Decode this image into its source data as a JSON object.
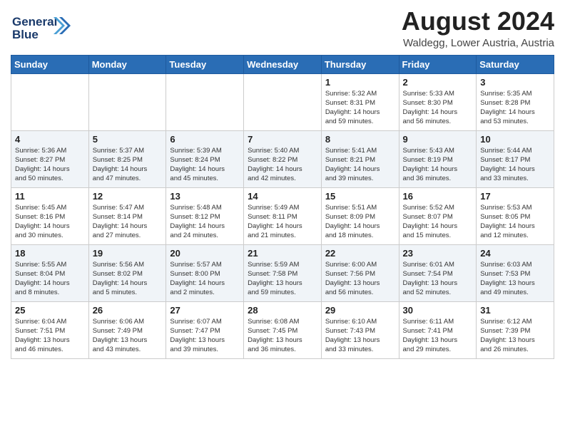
{
  "header": {
    "logo_line1": "General",
    "logo_line2": "Blue",
    "month_year": "August 2024",
    "location": "Waldegg, Lower Austria, Austria"
  },
  "days_of_week": [
    "Sunday",
    "Monday",
    "Tuesday",
    "Wednesday",
    "Thursday",
    "Friday",
    "Saturday"
  ],
  "weeks": [
    [
      {
        "empty": true
      },
      {
        "empty": true
      },
      {
        "empty": true
      },
      {
        "empty": true
      },
      {
        "day": 1,
        "sunrise": "5:32 AM",
        "sunset": "8:31 PM",
        "daylight": "14 hours and 59 minutes."
      },
      {
        "day": 2,
        "sunrise": "5:33 AM",
        "sunset": "8:30 PM",
        "daylight": "14 hours and 56 minutes."
      },
      {
        "day": 3,
        "sunrise": "5:35 AM",
        "sunset": "8:28 PM",
        "daylight": "14 hours and 53 minutes."
      }
    ],
    [
      {
        "day": 4,
        "sunrise": "5:36 AM",
        "sunset": "8:27 PM",
        "daylight": "14 hours and 50 minutes."
      },
      {
        "day": 5,
        "sunrise": "5:37 AM",
        "sunset": "8:25 PM",
        "daylight": "14 hours and 47 minutes."
      },
      {
        "day": 6,
        "sunrise": "5:39 AM",
        "sunset": "8:24 PM",
        "daylight": "14 hours and 45 minutes."
      },
      {
        "day": 7,
        "sunrise": "5:40 AM",
        "sunset": "8:22 PM",
        "daylight": "14 hours and 42 minutes."
      },
      {
        "day": 8,
        "sunrise": "5:41 AM",
        "sunset": "8:21 PM",
        "daylight": "14 hours and 39 minutes."
      },
      {
        "day": 9,
        "sunrise": "5:43 AM",
        "sunset": "8:19 PM",
        "daylight": "14 hours and 36 minutes."
      },
      {
        "day": 10,
        "sunrise": "5:44 AM",
        "sunset": "8:17 PM",
        "daylight": "14 hours and 33 minutes."
      }
    ],
    [
      {
        "day": 11,
        "sunrise": "5:45 AM",
        "sunset": "8:16 PM",
        "daylight": "14 hours and 30 minutes."
      },
      {
        "day": 12,
        "sunrise": "5:47 AM",
        "sunset": "8:14 PM",
        "daylight": "14 hours and 27 minutes."
      },
      {
        "day": 13,
        "sunrise": "5:48 AM",
        "sunset": "8:12 PM",
        "daylight": "14 hours and 24 minutes."
      },
      {
        "day": 14,
        "sunrise": "5:49 AM",
        "sunset": "8:11 PM",
        "daylight": "14 hours and 21 minutes."
      },
      {
        "day": 15,
        "sunrise": "5:51 AM",
        "sunset": "8:09 PM",
        "daylight": "14 hours and 18 minutes."
      },
      {
        "day": 16,
        "sunrise": "5:52 AM",
        "sunset": "8:07 PM",
        "daylight": "14 hours and 15 minutes."
      },
      {
        "day": 17,
        "sunrise": "5:53 AM",
        "sunset": "8:05 PM",
        "daylight": "14 hours and 12 minutes."
      }
    ],
    [
      {
        "day": 18,
        "sunrise": "5:55 AM",
        "sunset": "8:04 PM",
        "daylight": "14 hours and 8 minutes."
      },
      {
        "day": 19,
        "sunrise": "5:56 AM",
        "sunset": "8:02 PM",
        "daylight": "14 hours and 5 minutes."
      },
      {
        "day": 20,
        "sunrise": "5:57 AM",
        "sunset": "8:00 PM",
        "daylight": "14 hours and 2 minutes."
      },
      {
        "day": 21,
        "sunrise": "5:59 AM",
        "sunset": "7:58 PM",
        "daylight": "13 hours and 59 minutes."
      },
      {
        "day": 22,
        "sunrise": "6:00 AM",
        "sunset": "7:56 PM",
        "daylight": "13 hours and 56 minutes."
      },
      {
        "day": 23,
        "sunrise": "6:01 AM",
        "sunset": "7:54 PM",
        "daylight": "13 hours and 52 minutes."
      },
      {
        "day": 24,
        "sunrise": "6:03 AM",
        "sunset": "7:53 PM",
        "daylight": "13 hours and 49 minutes."
      }
    ],
    [
      {
        "day": 25,
        "sunrise": "6:04 AM",
        "sunset": "7:51 PM",
        "daylight": "13 hours and 46 minutes."
      },
      {
        "day": 26,
        "sunrise": "6:06 AM",
        "sunset": "7:49 PM",
        "daylight": "13 hours and 43 minutes."
      },
      {
        "day": 27,
        "sunrise": "6:07 AM",
        "sunset": "7:47 PM",
        "daylight": "13 hours and 39 minutes."
      },
      {
        "day": 28,
        "sunrise": "6:08 AM",
        "sunset": "7:45 PM",
        "daylight": "13 hours and 36 minutes."
      },
      {
        "day": 29,
        "sunrise": "6:10 AM",
        "sunset": "7:43 PM",
        "daylight": "13 hours and 33 minutes."
      },
      {
        "day": 30,
        "sunrise": "6:11 AM",
        "sunset": "7:41 PM",
        "daylight": "13 hours and 29 minutes."
      },
      {
        "day": 31,
        "sunrise": "6:12 AM",
        "sunset": "7:39 PM",
        "daylight": "13 hours and 26 minutes."
      }
    ]
  ],
  "labels": {
    "sunrise": "Sunrise:",
    "sunset": "Sunset:",
    "daylight": "Daylight:"
  }
}
